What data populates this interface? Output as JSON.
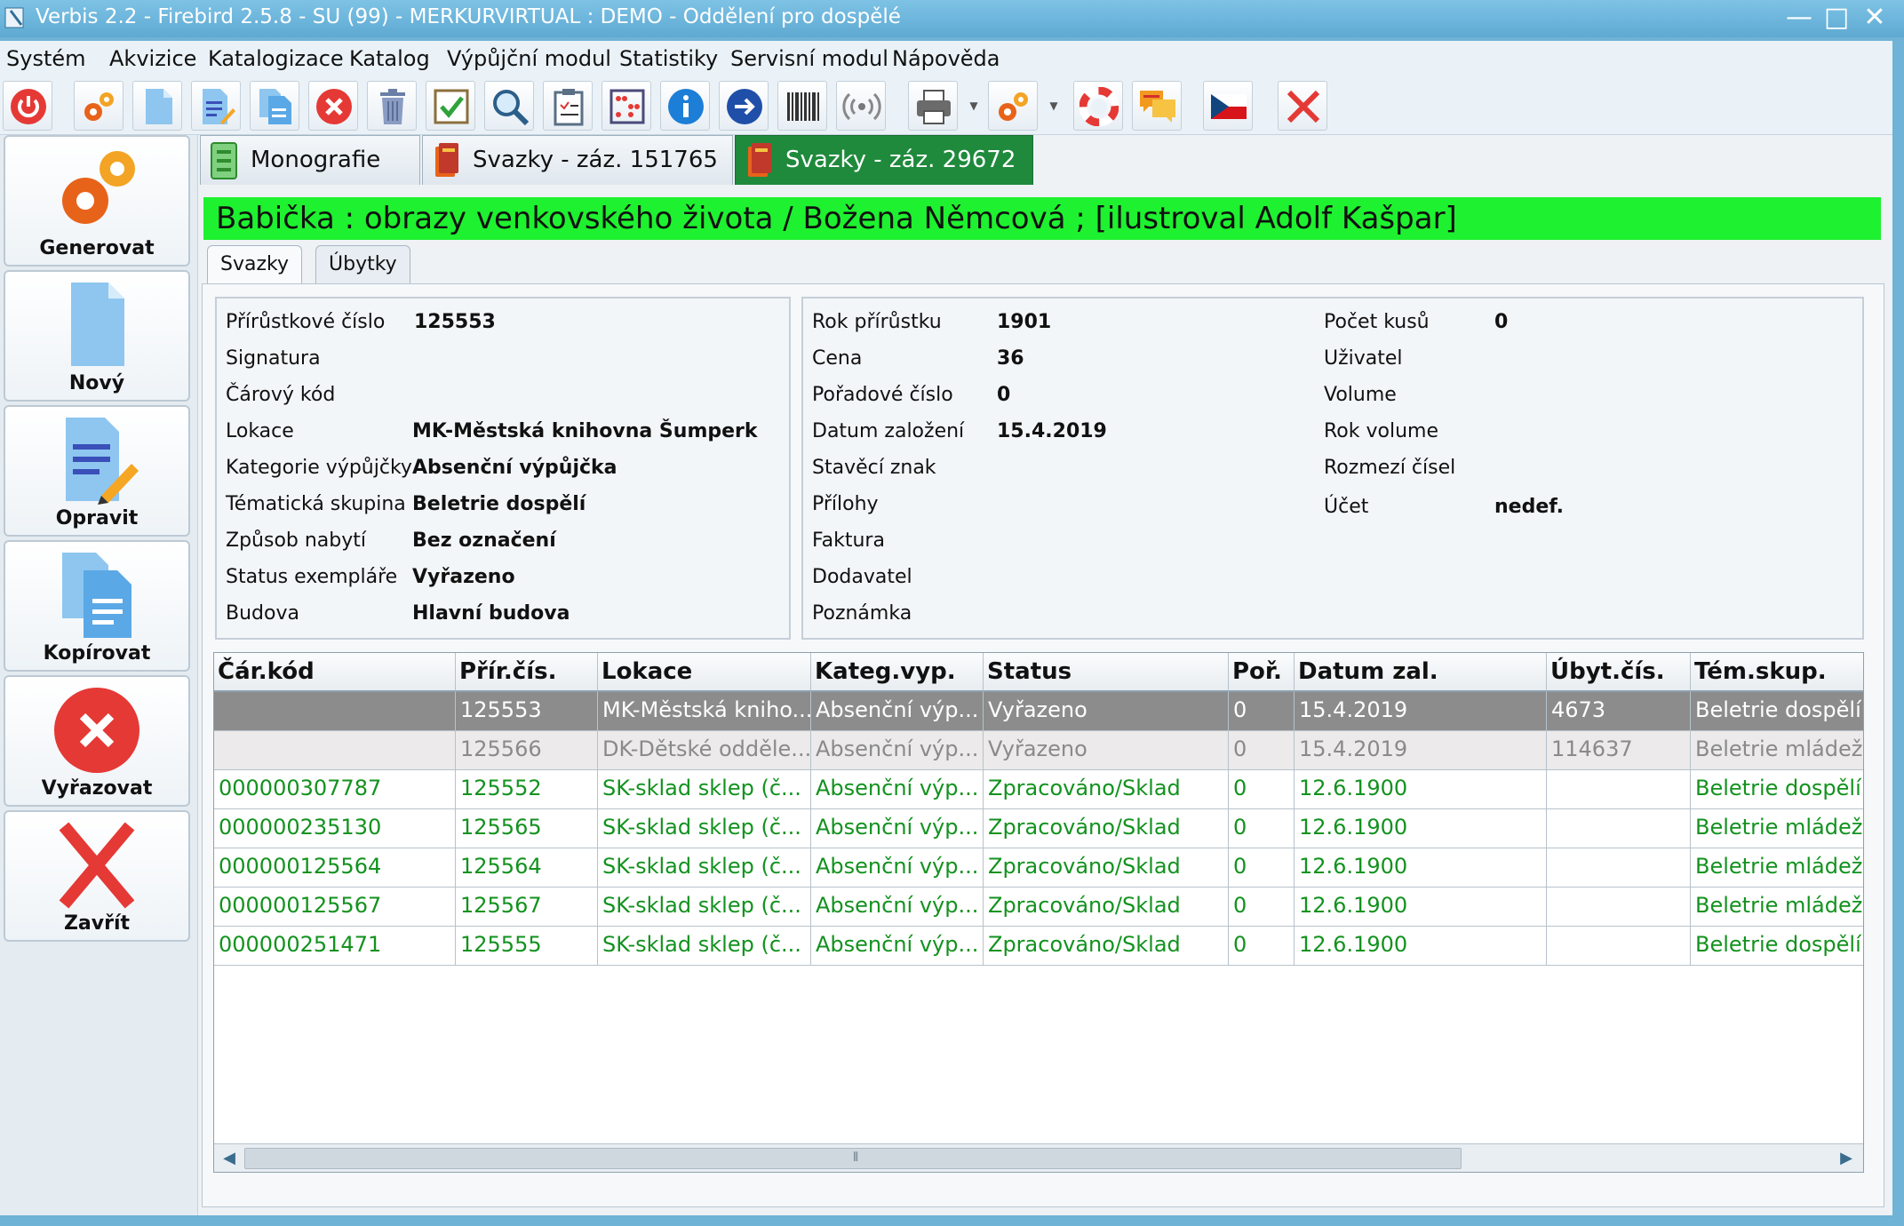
{
  "window": {
    "title": "Verbis 2.2 - Firebird 2.5.8 - SU (99) - MERKURVIRTUAL : DEMO - Oddělení pro dospělé",
    "minimize": "—",
    "maximize": "□",
    "close": "✕"
  },
  "menu": [
    "Systém",
    "Akvizice",
    "Katalogizace",
    "Katalog",
    "Výpůjční modul",
    "Statistiky",
    "Servisní modul",
    "Nápověda"
  ],
  "toolbar": {
    "icons": [
      "power-icon",
      "gears-icon",
      "new-document-icon",
      "edit-document-icon",
      "copy-document-icon",
      "delete-icon",
      "trash-icon",
      "checkbox-icon",
      "search-icon",
      "clipboard-icon",
      "abacus-icon",
      "info-icon",
      "arrow-right-icon",
      "barcode-icon",
      "rfid-icon",
      "printer-icon",
      "settings-icon",
      "help-lifebuoy-icon",
      "messages-icon",
      "czech-flag-icon",
      "close-icon"
    ]
  },
  "left_panel": {
    "generate": "Generovat",
    "new": "Nový",
    "edit": "Opravit",
    "copy": "Kopírovat",
    "discard": "Vyřazovat",
    "close": "Zavřít"
  },
  "doc_tabs": [
    "Monografie",
    "Svazky - záz. 151765",
    "Svazky - záz. 29672"
  ],
  "record_title": "Babička : obrazy venkovského života / Božena Němcová ; [ilustroval Adolf Kašpar]",
  "sub_tabs": [
    "Svazky",
    "Úbytky"
  ],
  "details": {
    "left": [
      {
        "label": "Přírůstkové číslo",
        "value": "125553"
      },
      {
        "label": "Signatura",
        "value": ""
      },
      {
        "label": "Čárový kód",
        "value": ""
      },
      {
        "label": "Lokace",
        "value": "MK-Městská knihovna Šumperk"
      },
      {
        "label": "Kategorie výpůjčky",
        "value": "Absenční výpůjčka"
      },
      {
        "label": "Tématická skupina",
        "value": "Beletrie dospělí"
      },
      {
        "label": "Způsob nabytí",
        "value": "Bez označení"
      },
      {
        "label": "Status exempláře",
        "value": "Vyřazeno"
      },
      {
        "label": "Budova",
        "value": "Hlavní budova"
      }
    ],
    "middle": [
      {
        "label": "Rok přírůstku",
        "value": "1901"
      },
      {
        "label": "Cena",
        "value": "36"
      },
      {
        "label": "Pořadové číslo",
        "value": "0"
      },
      {
        "label": "Datum založení",
        "value": "15.4.2019"
      },
      {
        "label": "Stavěcí znak",
        "value": ""
      },
      {
        "label": "Přílohy",
        "value": ""
      },
      {
        "label": "Faktura",
        "value": ""
      },
      {
        "label": "Dodavatel",
        "value": ""
      },
      {
        "label": "Poznámka",
        "value": ""
      }
    ],
    "right": [
      {
        "label": "Počet kusů",
        "value": "0"
      },
      {
        "label": "Uživatel",
        "value": ""
      },
      {
        "label": "Volume",
        "value": ""
      },
      {
        "label": "Rok volume",
        "value": ""
      },
      {
        "label": "Rozmezí čísel",
        "value": ""
      },
      {
        "label": "Účet",
        "value": "nedef."
      }
    ]
  },
  "grid": {
    "columns": [
      "Čár.kód",
      "Přír.čís.",
      "Lokace",
      "Kateg.vyp.",
      "Status",
      "Poř.",
      "Datum zal.",
      "Úbyt.čís.",
      "Tém.skup."
    ],
    "rows": [
      [
        "",
        "125553",
        "MK-Městská kniho...",
        "Absenční výp...",
        "Vyřazeno",
        "0",
        "15.4.2019",
        "4673",
        "Beletrie dospělí"
      ],
      [
        "",
        "125566",
        "DK-Dětské odděle...",
        "Absenční výp...",
        "Vyřazeno",
        "0",
        "15.4.2019",
        "114637",
        "Beletrie mládež"
      ],
      [
        "000000307787",
        "125552",
        "SK-sklad sklep (č...",
        "Absenční výp...",
        "Zpracováno/Sklad",
        "0",
        "12.6.1900",
        "",
        "Beletrie dospělí"
      ],
      [
        "000000235130",
        "125565",
        "SK-sklad sklep (č...",
        "Absenční výp...",
        "Zpracováno/Sklad",
        "0",
        "12.6.1900",
        "",
        "Beletrie mládež"
      ],
      [
        "000000125564",
        "125564",
        "SK-sklad sklep (č...",
        "Absenční výp...",
        "Zpracováno/Sklad",
        "0",
        "12.6.1900",
        "",
        "Beletrie mládež"
      ],
      [
        "000000125567",
        "125567",
        "SK-sklad sklep (č...",
        "Absenční výp...",
        "Zpracováno/Sklad",
        "0",
        "12.6.1900",
        "",
        "Beletrie mládež"
      ],
      [
        "000000251471",
        "125555",
        "SK-sklad sklep (č...",
        "Absenční výp...",
        "Zpracováno/Sklad",
        "0",
        "12.6.1900",
        "",
        "Beletrie dospělí"
      ]
    ],
    "row_styles": [
      "selected",
      "discarded",
      "available",
      "available",
      "available",
      "available",
      "available"
    ],
    "scroll_grip": "⦀"
  },
  "colors": {
    "banner": "#1ef12f",
    "active_tab": "#1f8a3c",
    "available_text": "#13921f",
    "selected_row": "#8c8c8c"
  }
}
